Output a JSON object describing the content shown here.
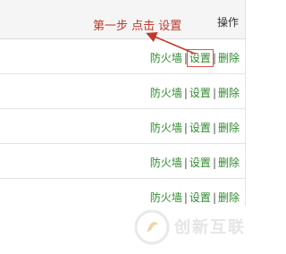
{
  "header": {
    "op_label": "操作",
    "annotation": "第一步 点击 设置"
  },
  "rows": [
    {
      "firewall": "防火墙",
      "sep1": "|",
      "settings": "设置",
      "sep2": "|",
      "delete": "删除"
    },
    {
      "firewall": "防火墙",
      "sep1": "|",
      "settings": "设置",
      "sep2": "|",
      "delete": "删除"
    },
    {
      "firewall": "防火墙",
      "sep1": "|",
      "settings": "设置",
      "sep2": "|",
      "delete": "删除"
    },
    {
      "firewall": "防火墙",
      "sep1": "|",
      "settings": "设置",
      "sep2": "|",
      "delete": "删除"
    },
    {
      "firewall": "防火墙",
      "sep1": "|",
      "settings": "设置",
      "sep2": "|",
      "delete": "删除"
    }
  ],
  "watermark": {
    "text": "创新互联",
    "logo": "flame-logo"
  },
  "colors": {
    "action_link": "#2e8b2e",
    "annotation": "#c0392b",
    "highlight_box": "#d9534f"
  }
}
